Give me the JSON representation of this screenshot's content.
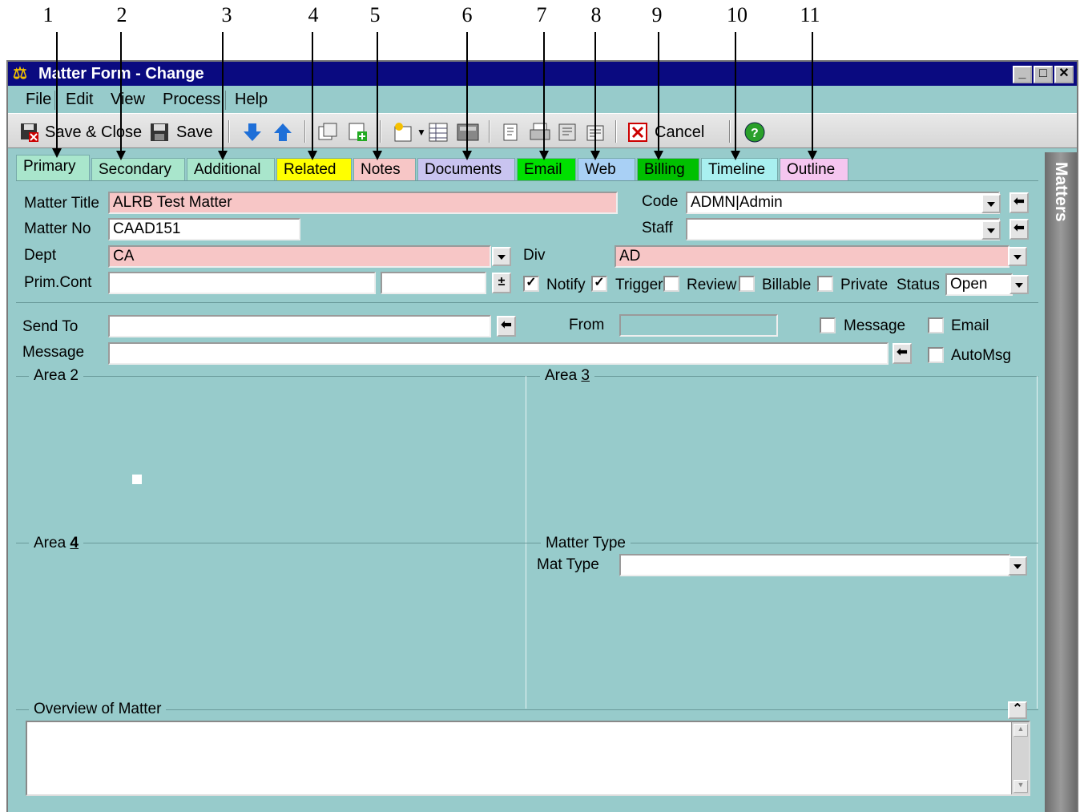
{
  "callouts": [
    "1",
    "2",
    "3",
    "4",
    "5",
    "6",
    "7",
    "8",
    "9",
    "10",
    "11"
  ],
  "window": {
    "title": "Matter Form - Change"
  },
  "menu": [
    "File",
    "Edit",
    "View",
    "Process",
    "Help"
  ],
  "toolbar": {
    "save_close": "Save & Close",
    "save": "Save",
    "cancel": "Cancel"
  },
  "tabs": [
    {
      "label": "Primary",
      "color": "#a9e6cc"
    },
    {
      "label": "Secondary",
      "color": "#a9e6cc"
    },
    {
      "label": "Additional",
      "color": "#a9e6cc"
    },
    {
      "label": "Related",
      "color": "#ffff00"
    },
    {
      "label": "Notes",
      "color": "#f7c6c6"
    },
    {
      "label": "Documents",
      "color": "#c9c4f0"
    },
    {
      "label": "Email",
      "color": "#00e000"
    },
    {
      "label": "Web",
      "color": "#a9d0f5"
    },
    {
      "label": "Billing",
      "color": "#00c000"
    },
    {
      "label": "Timeline",
      "color": "#a9f0f0"
    },
    {
      "label": "Outline",
      "color": "#f5c6f0"
    }
  ],
  "sidebar": {
    "label": "Matters"
  },
  "form": {
    "matter_title_label": "Matter Title",
    "matter_title_value": "ALRB Test Matter",
    "matter_no_label": "Matter No",
    "matter_no_value": "CAAD151",
    "dept_label": "Dept",
    "dept_value": "CA",
    "prim_cont_label": "Prim.Cont",
    "code_label": "Code",
    "code_value": "ADMN|Admin",
    "staff_label": "Staff",
    "div_label": "Div",
    "div_value": "AD",
    "notify_label": "Notify",
    "trigger_label": "Trigger",
    "review_label": "Review",
    "billable_label": "Billable",
    "private_label": "Private",
    "status_label": "Status",
    "status_value": "Open"
  },
  "message": {
    "send_to_label": "Send To",
    "from_label": "From",
    "message_cb_label": "Message",
    "email_cb_label": "Email",
    "message_label": "Message",
    "automsg_label": "AutoMsg"
  },
  "areas": {
    "area2": "Area 2",
    "area3_prefix": "Area ",
    "area3_num": "3",
    "area4_prefix": "Area ",
    "area4_num": "4",
    "matter_type": "Matter Type",
    "mat_type_label": "Mat Type",
    "overview": "Overview of Matter"
  }
}
